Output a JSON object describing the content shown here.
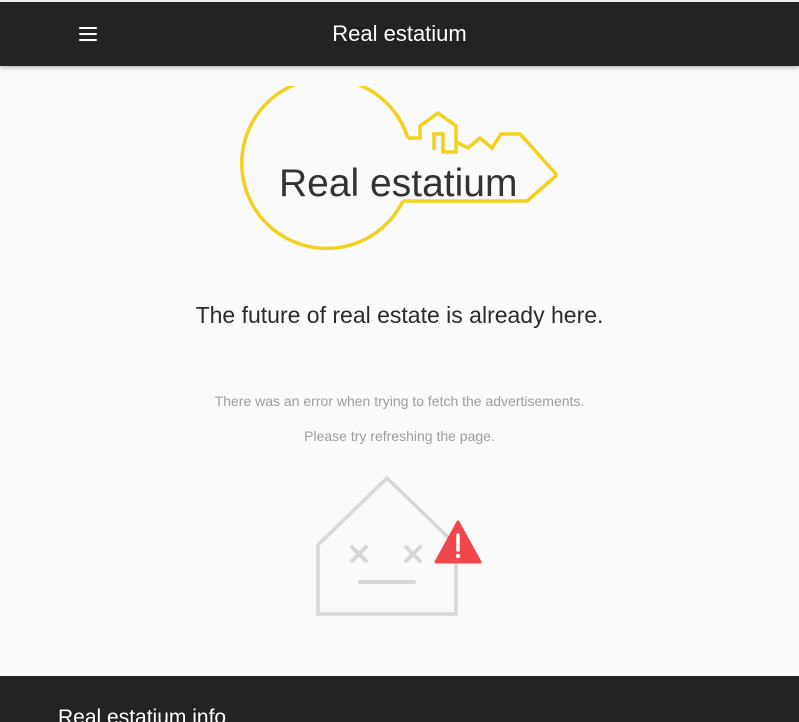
{
  "appbar": {
    "title": "Real estatium",
    "menu_icon": "hamburger-menu-icon"
  },
  "logo": {
    "brand_text": "Real estatium",
    "accent_color": "#F2D11F",
    "text_color": "#333333"
  },
  "hero": {
    "tagline": "The future of real estate is already here."
  },
  "error": {
    "message": "There was an error when trying to fetch the advertisements.",
    "hint": "Please try refreshing the page.",
    "illustration_icon": "broken-house-warning-icon",
    "warning_color": "#F0474D",
    "illustration_color": "#D8D8D8"
  },
  "footer": {
    "title": "Real estatium info"
  },
  "colors": {
    "appbar": "#232323",
    "background": "#FAFAFA"
  }
}
